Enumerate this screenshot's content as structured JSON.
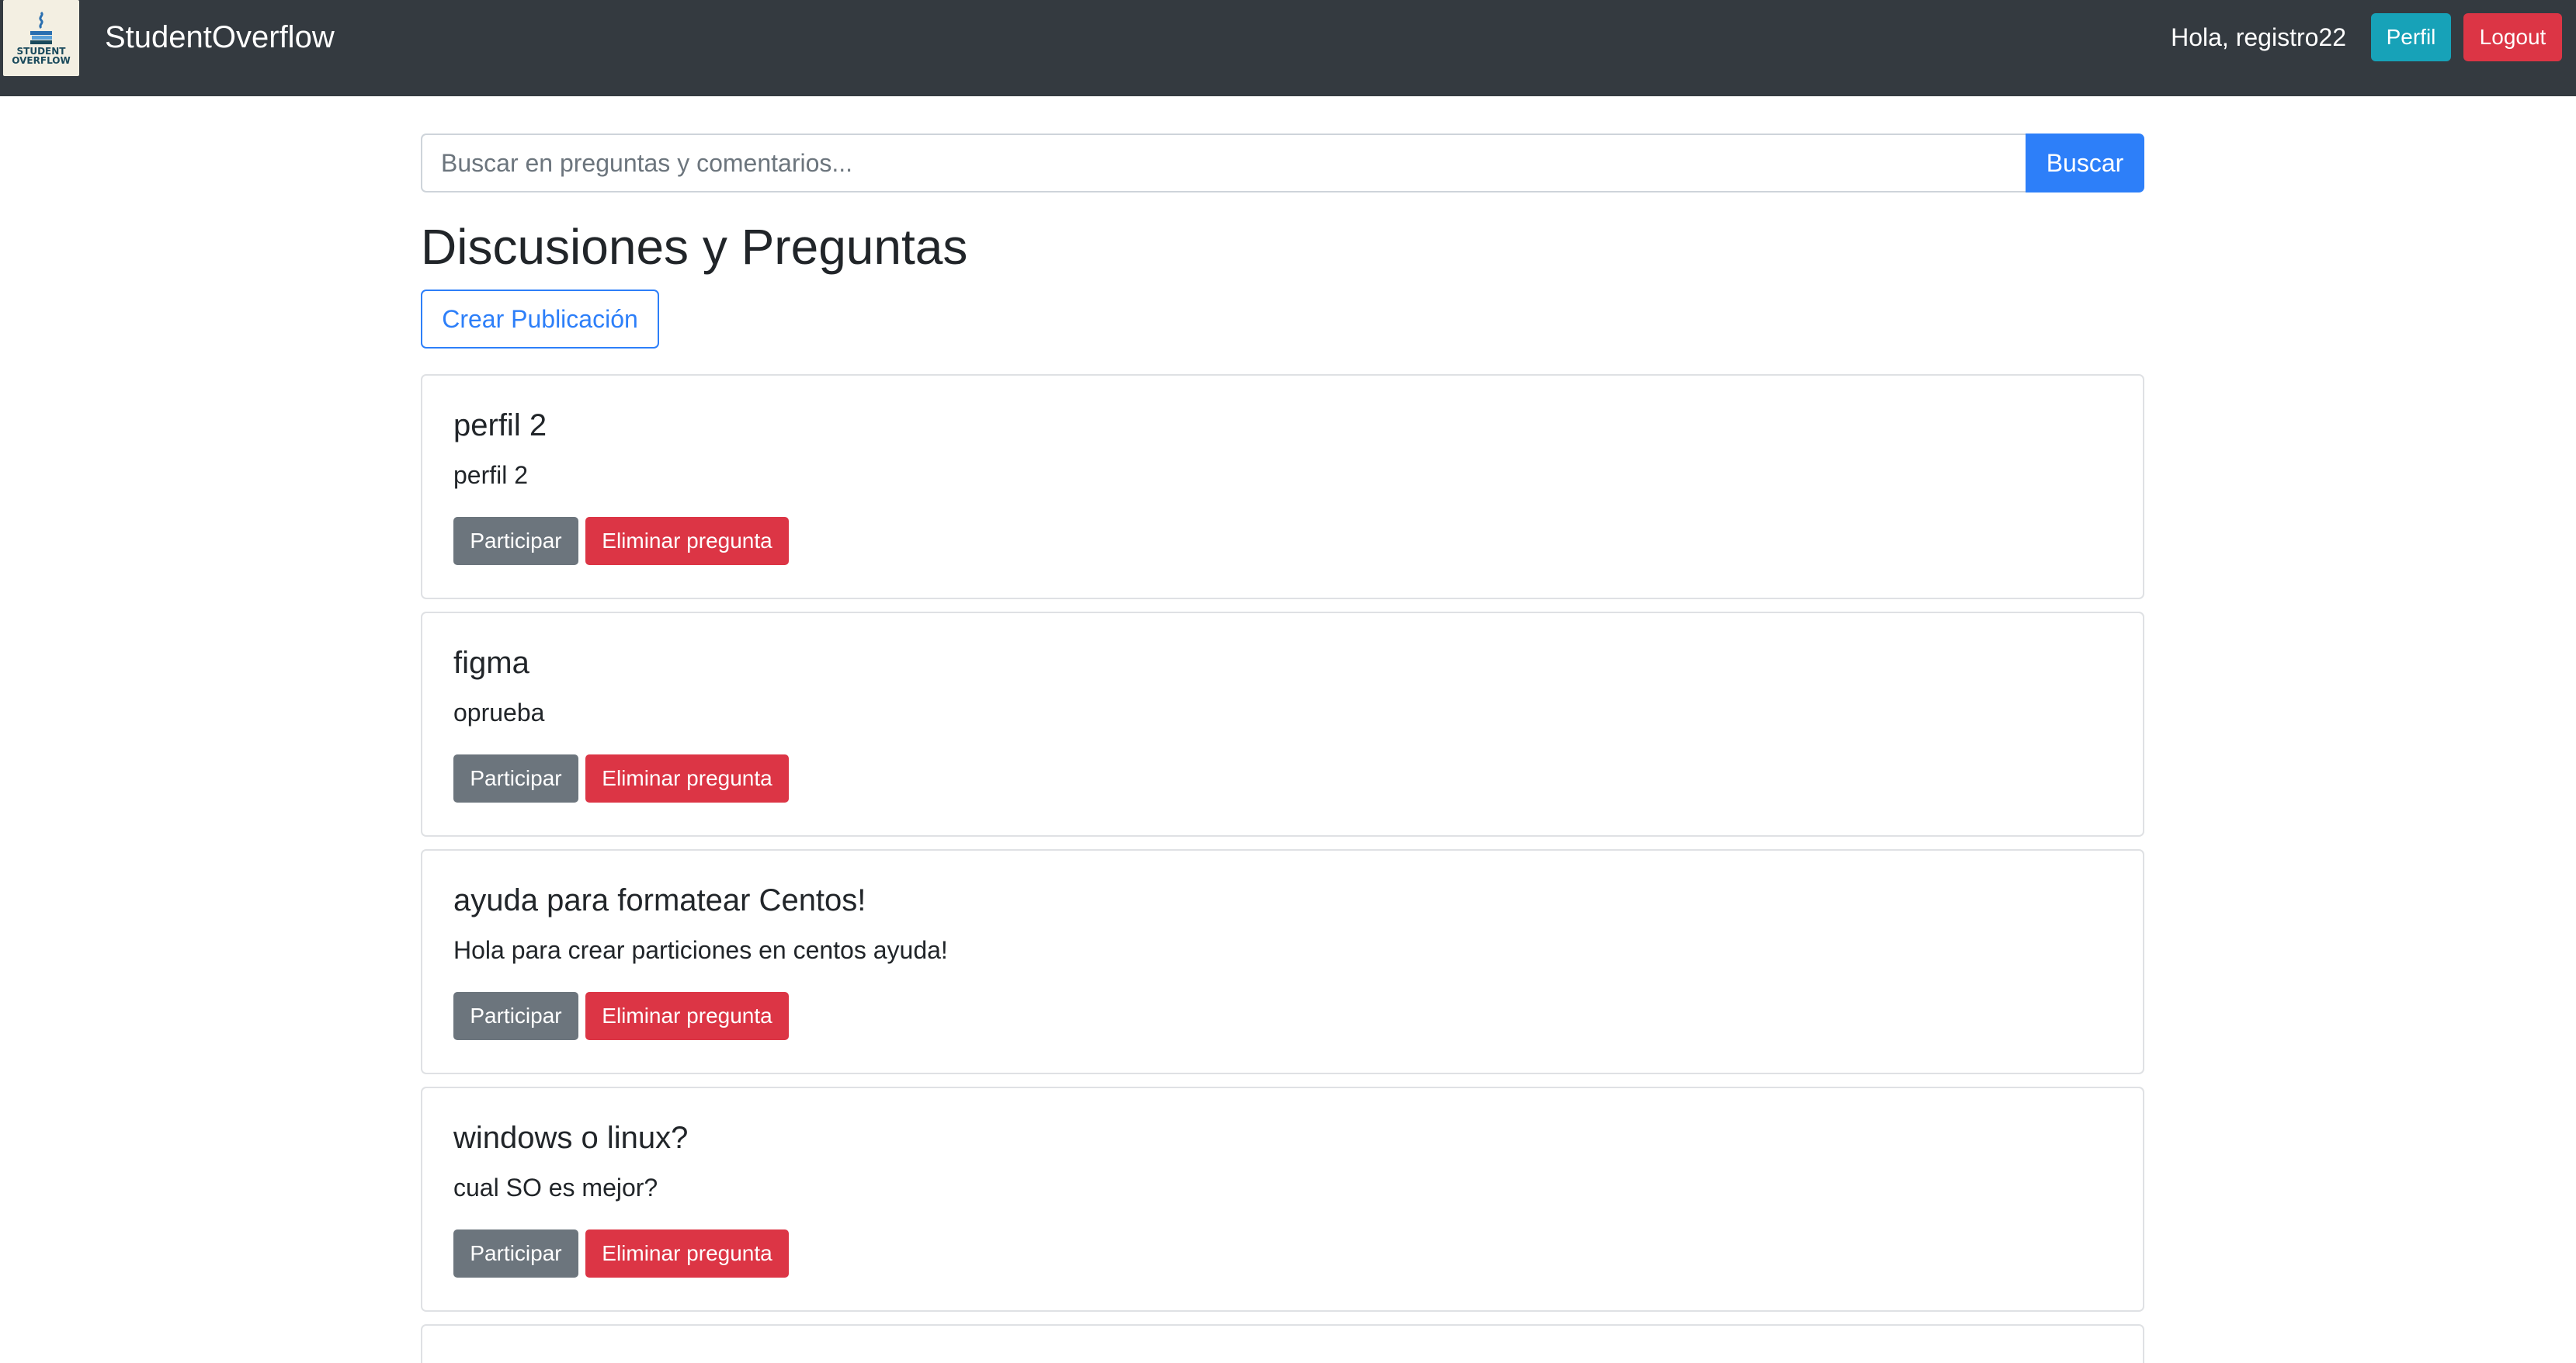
{
  "navbar": {
    "logo_text_line1": "STUDENT",
    "logo_text_line2": "OVERFLOW",
    "brand": "StudentOverflow",
    "greeting": "Hola, registro22",
    "profile_label": "Perfil",
    "logout_label": "Logout"
  },
  "search": {
    "placeholder": "Buscar en preguntas y comentarios...",
    "button_label": "Buscar"
  },
  "main": {
    "title": "Discusiones y Preguntas",
    "create_label": "Crear Publicación"
  },
  "questions": [
    {
      "title": "perfil 2",
      "body": "perfil 2",
      "participate_label": "Participar",
      "delete_label": "Eliminar pregunta"
    },
    {
      "title": "figma",
      "body": "oprueba",
      "participate_label": "Participar",
      "delete_label": "Eliminar pregunta"
    },
    {
      "title": "ayuda para formatear Centos!",
      "body": "Hola para crear particiones en centos ayuda!",
      "participate_label": "Participar",
      "delete_label": "Eliminar pregunta"
    },
    {
      "title": "windows o linux?",
      "body": "cual SO es mejor?",
      "participate_label": "Participar",
      "delete_label": "Eliminar pregunta"
    }
  ],
  "colors": {
    "navbar": "#343a40",
    "primary": "#2d7ff9",
    "info": "#17a2b8",
    "danger": "#dc3545",
    "secondary": "#6c757d"
  }
}
